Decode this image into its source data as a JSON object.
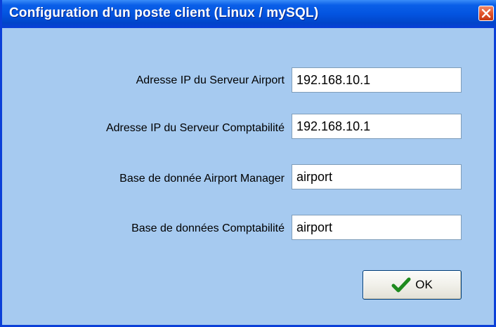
{
  "window": {
    "title": "Configuration d'un poste client (Linux / mySQL)"
  },
  "fields": [
    {
      "label": "Adresse IP du Serveur Airport",
      "value": "192.168.10.1"
    },
    {
      "label": "Adresse IP du Serveur Comptabilité",
      "value": "192.168.10.1"
    },
    {
      "label": "Base de donnée Airport Manager",
      "value": "airport"
    },
    {
      "label": "Base de données Comptabilité",
      "value": "airport"
    }
  ],
  "buttons": {
    "ok_label": "OK",
    "ok_icon": "checkmark-icon",
    "close_icon": "close-icon"
  },
  "colors": {
    "dialog_background": "#a6caf0",
    "titlebar": "#0354e0",
    "close_button": "#e2542c",
    "checkmark": "#1e8a1e"
  }
}
